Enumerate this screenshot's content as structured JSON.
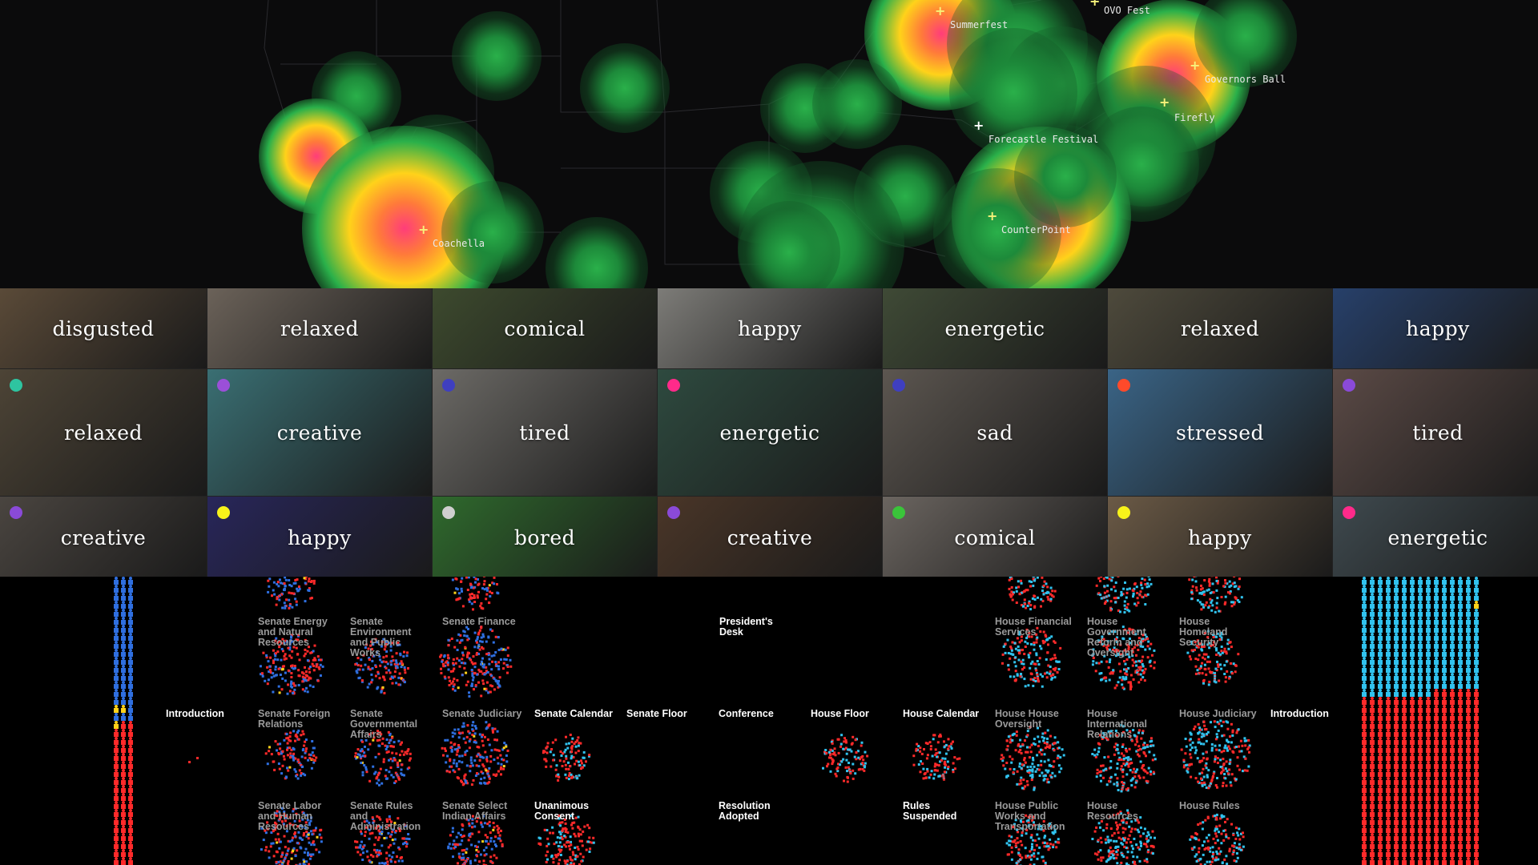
{
  "colors": {
    "dem": "#2f6fe0",
    "rep": "#ff2a2a",
    "ind": "#ffd21a",
    "house_dem": "#31c2ee",
    "heat_core": "#ff3d7a",
    "heat_mid": "#ffd21a",
    "heat_outer": "#2ab04a"
  },
  "map": {
    "festivals": [
      {
        "label": "Summerfest"
      },
      {
        "label": "OVO Fest"
      },
      {
        "label": "Governors Ball"
      },
      {
        "label": "Firefly"
      },
      {
        "label": "Forecastle Festival"
      },
      {
        "label": "Coachella"
      },
      {
        "label": "CounterPoint"
      }
    ]
  },
  "tiles": [
    {
      "mood": "disgusted",
      "dot": null,
      "bg": "#5a4a38"
    },
    {
      "mood": "relaxed",
      "dot": null,
      "bg": "#6b6259"
    },
    {
      "mood": "comical",
      "dot": null,
      "bg": "#3d4a2e"
    },
    {
      "mood": "happy",
      "dot": null,
      "bg": "#7d7c78"
    },
    {
      "mood": "energetic",
      "dot": null,
      "bg": "#3f4a36"
    },
    {
      "mood": "relaxed",
      "dot": null,
      "bg": "#4e4a3c"
    },
    {
      "mood": "happy",
      "dot": null,
      "bg": "#27406a"
    },
    {
      "mood": "relaxed",
      "dot": "#2ec4a0",
      "bg": "#4d4436"
    },
    {
      "mood": "creative",
      "dot": "#9b4fd8",
      "bg": "#3a6f73"
    },
    {
      "mood": "tired",
      "dot": "#3f3fc0",
      "bg": "#6c6a66"
    },
    {
      "mood": "energetic",
      "dot": "#ff2a8a",
      "bg": "#2e4a3f"
    },
    {
      "mood": "sad",
      "dot": "#3f3fc0",
      "bg": "#5c5650"
    },
    {
      "mood": "stressed",
      "dot": "#ff4a2a",
      "bg": "#3a6486"
    },
    {
      "mood": "tired",
      "dot": "#8a4ad8",
      "bg": "#5b4a46"
    },
    {
      "mood": "creative",
      "dot": "#8a4ad8",
      "bg": "#4a4540"
    },
    {
      "mood": "happy",
      "dot": "#f7f21a",
      "bg": "#28265a"
    },
    {
      "mood": "bored",
      "dot": "#cfcfcf",
      "bg": "#2f6a2d"
    },
    {
      "mood": "creative",
      "dot": "#8a4ad8",
      "bg": "#4a3628"
    },
    {
      "mood": "comical",
      "dot": "#3ac43a",
      "bg": "#6b6560"
    },
    {
      "mood": "happy",
      "dot": "#f7f21a",
      "bg": "#6b5a46"
    },
    {
      "mood": "energetic",
      "dot": "#ff2a8a",
      "bg": "#3f4a4f"
    }
  ],
  "legislation": {
    "left_intro": "Introduction",
    "right_intro": "Introduction",
    "labels": [
      {
        "text": "Senate Energy and Natural Resources",
        "white": false
      },
      {
        "text": "Senate Environment and Public Works",
        "white": false
      },
      {
        "text": "Senate Finance",
        "white": false
      },
      {
        "text": "President's Desk",
        "white": true
      },
      {
        "text": "House Financial Services",
        "white": false
      },
      {
        "text": "House Government Reform and Oversight",
        "white": false
      },
      {
        "text": "House Homeland Security",
        "white": false
      },
      {
        "text": "Senate Foreign Relations",
        "white": false
      },
      {
        "text": "Senate Governmental Affairs",
        "white": false
      },
      {
        "text": "Senate Judiciary",
        "white": false
      },
      {
        "text": "Senate Calendar",
        "white": true
      },
      {
        "text": "Senate Floor",
        "white": true
      },
      {
        "text": "Conference",
        "white": true
      },
      {
        "text": "House Floor",
        "white": true
      },
      {
        "text": "House Calendar",
        "white": true
      },
      {
        "text": "House House Oversight",
        "white": false
      },
      {
        "text": "House International Relations",
        "white": false
      },
      {
        "text": "House Judiciary",
        "white": false
      },
      {
        "text": "Senate Labor and Human Resources",
        "white": false
      },
      {
        "text": "Senate Rules and Administration",
        "white": false
      },
      {
        "text": "Senate Select Indian Affairs",
        "white": false
      },
      {
        "text": "Unanimous Consent",
        "white": true
      },
      {
        "text": "Resolution Adopted",
        "white": true
      },
      {
        "text": "Rules Suspended",
        "white": true
      },
      {
        "text": "House Public Works and Transportation",
        "white": false
      },
      {
        "text": "House Resources",
        "white": false
      },
      {
        "text": "House Rules",
        "white": false
      }
    ]
  }
}
